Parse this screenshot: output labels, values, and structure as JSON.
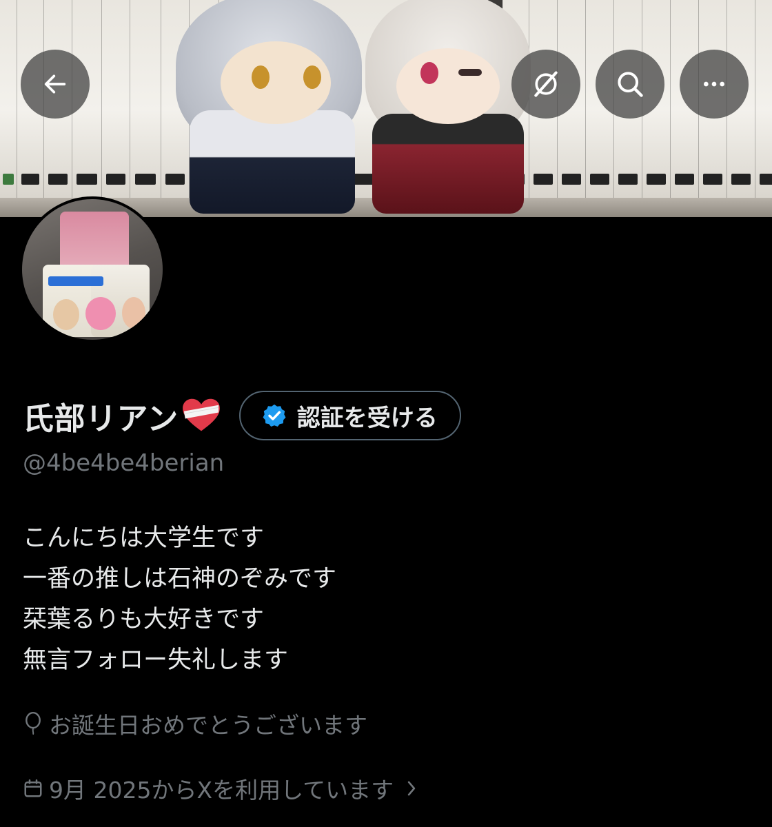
{
  "header": {
    "back_icon": "arrow-left-icon",
    "grok_icon": "grok-slash-circle-icon",
    "search_icon": "search-icon",
    "more_icon": "more-dots-icon"
  },
  "profile": {
    "display_name": "氏部リアン",
    "name_emoji": "mending-heart",
    "verify_button_label": "認証を受ける",
    "handle": "@4be4be4berian",
    "bio_lines": [
      "こんにちは大学生です",
      "一番の推しは石神のぞみです",
      "栞葉るりも大好きです",
      "無言フォロー失礼します"
    ],
    "birthday_text": "お誕生日おめでとうございます",
    "joined_text": "9月 2025からXを利用しています"
  },
  "colors": {
    "background": "#000000",
    "text_primary": "#e7e9ea",
    "text_secondary": "#71767b",
    "verified_blue": "#1d9bf0",
    "button_border": "#536471"
  }
}
